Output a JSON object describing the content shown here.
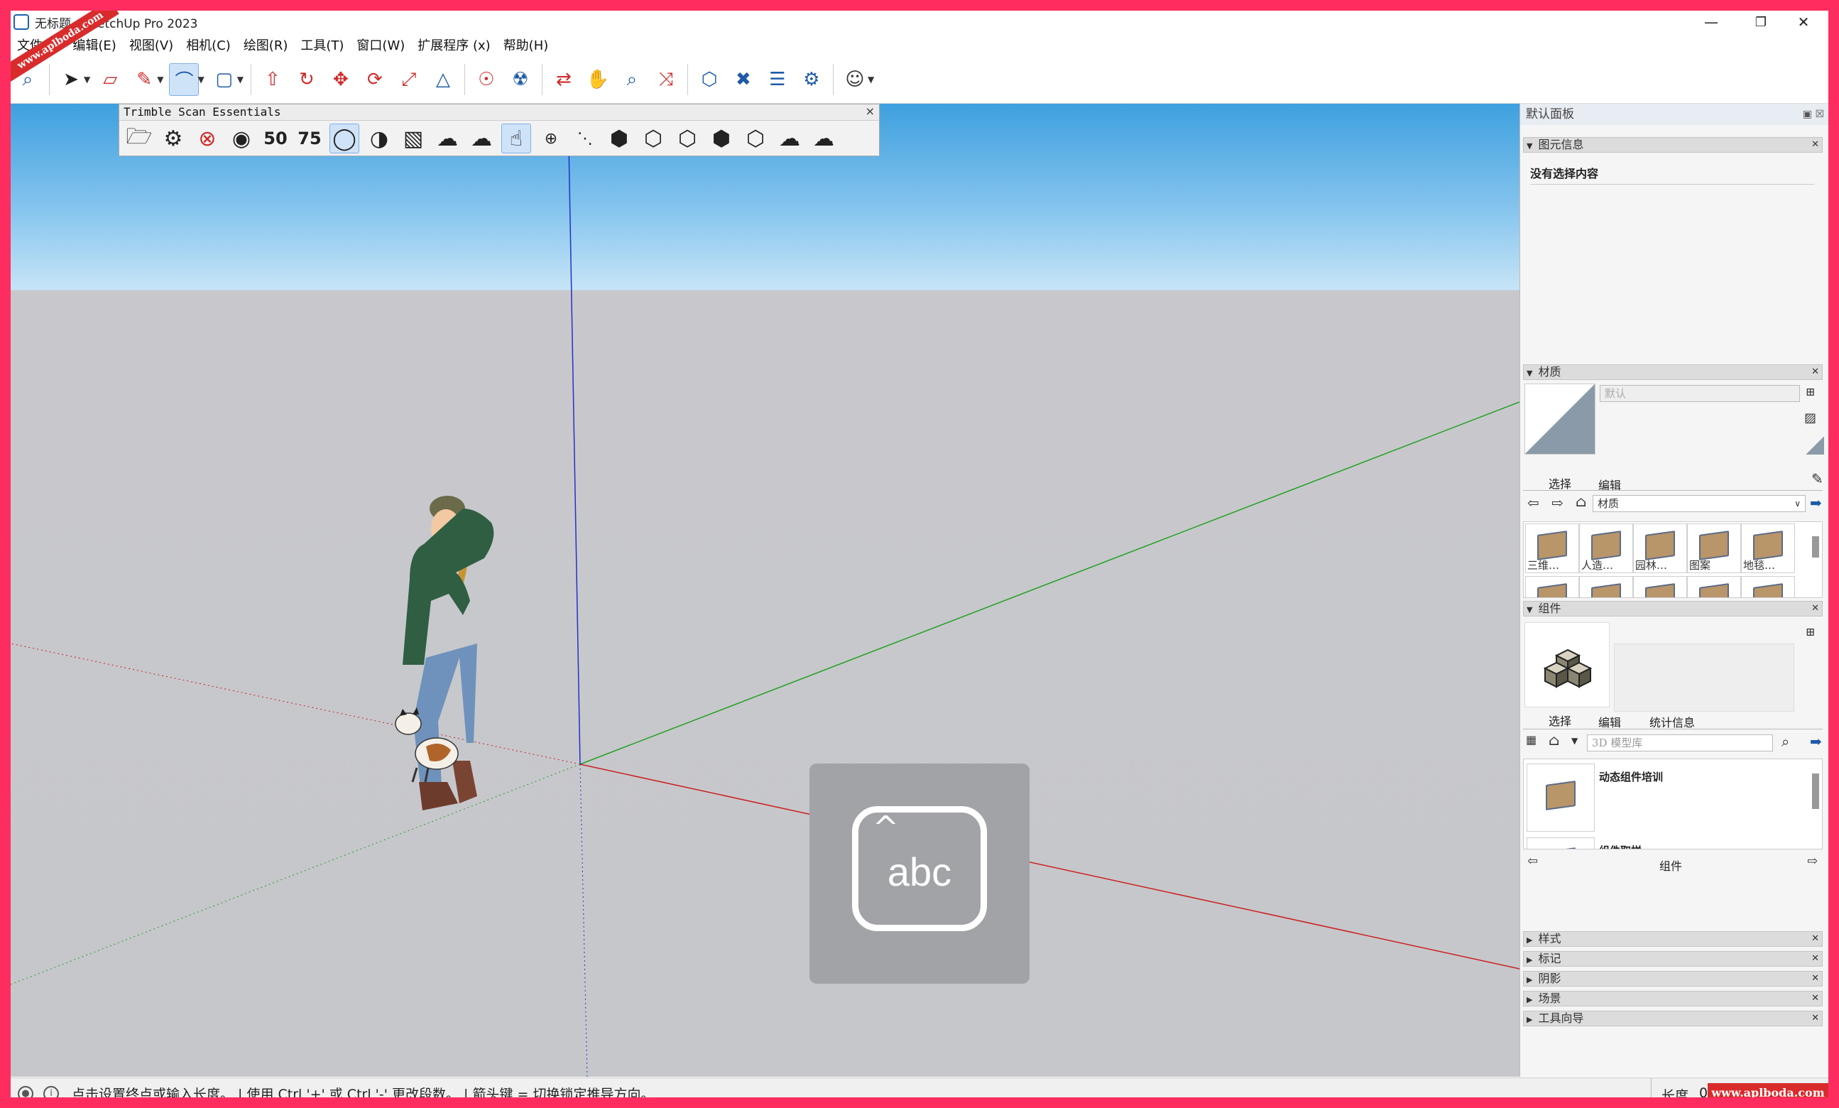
{
  "window": {
    "title": "无标题 - SketchUp Pro 2023",
    "minimize": "—",
    "maximize": "❐",
    "close": "✕"
  },
  "menu": [
    "文件(F)",
    "编辑(E)",
    "视图(V)",
    "相机(C)",
    "绘图(R)",
    "工具(T)",
    "窗口(W)",
    "扩展程序 (x)",
    "帮助(H)"
  ],
  "toolbar": {
    "icons": [
      "zoom-icon",
      "select-arrow-icon",
      "eraser-icon",
      "pencil-line-icon",
      "arc-icon",
      "rectangle-icon",
      "push-pull-icon",
      "follow-me-icon",
      "move-icon",
      "rotate-icon",
      "scale-icon",
      "flip-icon",
      "walk-icon",
      "paint-bucket-icon",
      "orbit-icon",
      "pan-icon",
      "zoom-icon",
      "zoom-extents-icon",
      "3d-warehouse-icon",
      "extension-warehouse-icon",
      "layout-icon",
      "extension-manager-icon",
      "account-icon"
    ]
  },
  "scan_toolbar": {
    "title": "Trimble Scan Essentials",
    "close": "×"
  },
  "ime": {
    "text": "abc",
    "caret": "^"
  },
  "panel": {
    "title": "默认面板",
    "entity_info": {
      "header": "图元信息",
      "empty_text": "没有选择内容"
    },
    "materials": {
      "header": "材质",
      "name": "默认",
      "tabs": [
        "选择",
        "编辑"
      ],
      "dropdown": "材质",
      "items": [
        "三维…",
        "人造…",
        "园林…",
        "图案",
        "地毯…"
      ]
    },
    "components": {
      "header": "组件",
      "tabs": [
        "选择",
        "编辑",
        "统计信息"
      ],
      "search_placeholder": "3D 模型库",
      "items": [
        "动态组件培训",
        "组件取样"
      ],
      "footer": "组件"
    },
    "collapsed": [
      "样式",
      "标记",
      "阴影",
      "场景",
      "工具向导"
    ]
  },
  "status": {
    "message": "点击设置终点或输入长度。 | 使用 Ctrl '+' 或 Ctrl '-' 更改段数。 | 箭头键 = 切换锁定推导方向。",
    "length_label": "长度",
    "length_value": "0.0"
  },
  "watermarks": {
    "corner": "www.aplboda.com",
    "bottom": "www.aplboda.com"
  },
  "colors": {
    "frame": "#ff2d5f",
    "x_axis": "#cc1f1f",
    "y_axis": "#22a022",
    "z_axis": "#2430c8"
  }
}
